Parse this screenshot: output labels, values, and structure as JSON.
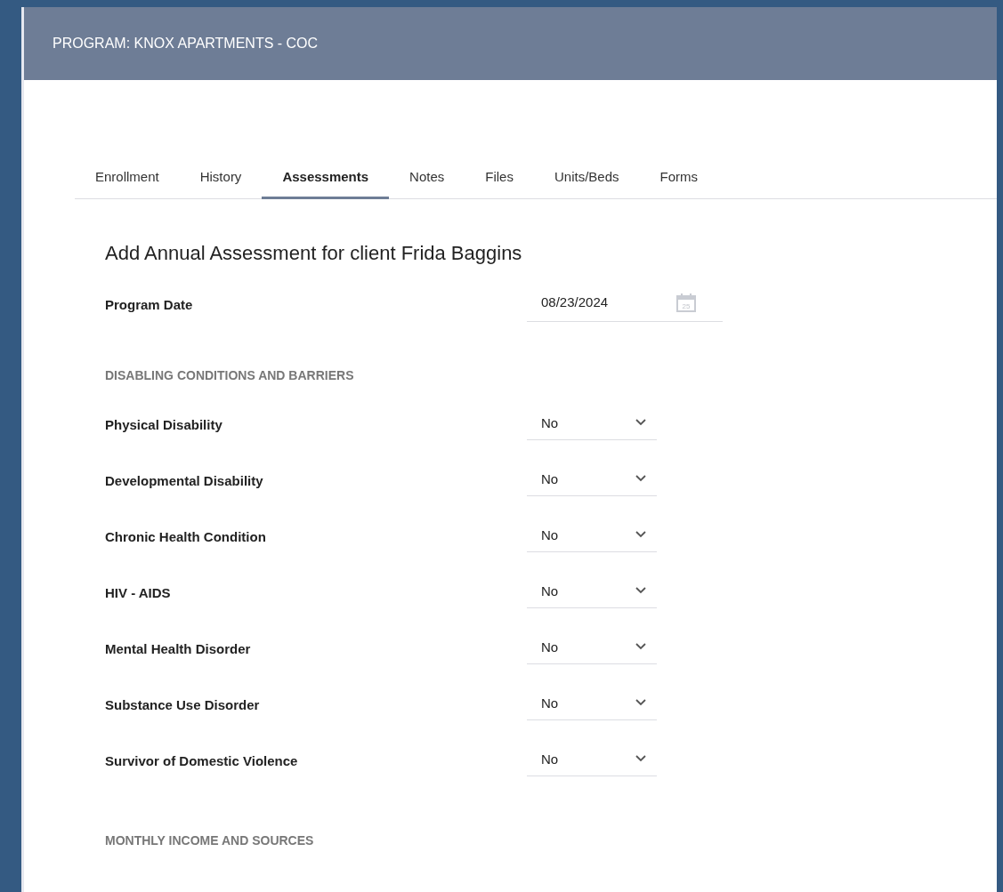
{
  "header": {
    "title": "PROGRAM: KNOX APARTMENTS - COC"
  },
  "tabs": [
    {
      "label": "Enrollment",
      "selected": false
    },
    {
      "label": "History",
      "selected": false
    },
    {
      "label": "Assessments",
      "selected": true
    },
    {
      "label": "Notes",
      "selected": false
    },
    {
      "label": "Files",
      "selected": false
    },
    {
      "label": "Units/Beds",
      "selected": false
    },
    {
      "label": "Forms",
      "selected": false
    }
  ],
  "form": {
    "heading": "Add Annual Assessment for client Frida Baggins",
    "sections": [
      {
        "fields": [
          {
            "kind": "date",
            "label": "Program Date",
            "value": "08/23/2024",
            "icon_day": "25"
          }
        ]
      },
      {
        "title": "DISABLING CONDITIONS AND BARRIERS",
        "fields": [
          {
            "kind": "select",
            "label": "Physical Disability",
            "value": "No"
          },
          {
            "kind": "select",
            "label": "Developmental Disability",
            "value": "No"
          },
          {
            "kind": "select",
            "label": "Chronic Health Condition",
            "value": "No"
          },
          {
            "kind": "select",
            "label": "HIV - AIDS",
            "value": "No"
          },
          {
            "kind": "select",
            "label": "Mental Health Disorder",
            "value": "No"
          },
          {
            "kind": "select",
            "label": "Substance Use Disorder",
            "value": "No"
          },
          {
            "kind": "select",
            "label": "Survivor of Domestic Violence",
            "value": "No"
          }
        ]
      },
      {
        "title": "MONTHLY INCOME AND SOURCES"
      }
    ]
  }
}
